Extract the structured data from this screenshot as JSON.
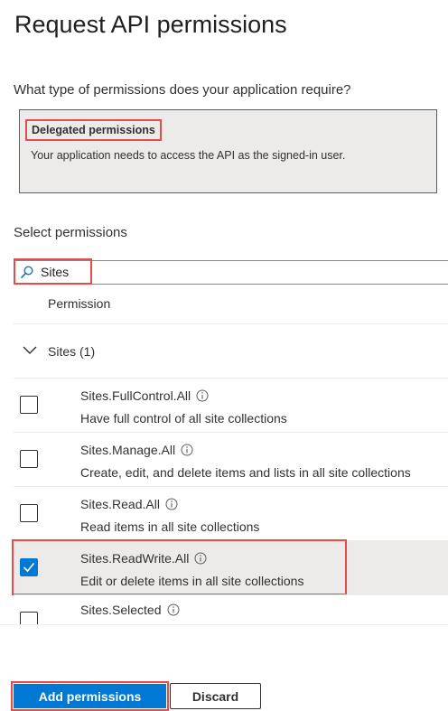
{
  "header": {
    "title": "Request API permissions",
    "question": "What type of permissions does your application require?"
  },
  "permission_type_card": {
    "title": "Delegated permissions",
    "description": "Your application needs to access the API as the signed-in user.",
    "selected": true
  },
  "select_section": {
    "label": "Select permissions",
    "search": {
      "value": "Sites",
      "icon": "search-icon"
    },
    "column_header": "Permission"
  },
  "group": {
    "label": "Sites (1)",
    "expanded": true,
    "icon": "chevron-down-icon"
  },
  "permissions": [
    {
      "name": "Sites.FullControl.All",
      "description": "Have full control of all site collections",
      "checked": false
    },
    {
      "name": "Sites.Manage.All",
      "description": "Create, edit, and delete items and lists in all site collections",
      "checked": false
    },
    {
      "name": "Sites.Read.All",
      "description": "Read items in all site collections",
      "checked": false
    },
    {
      "name": "Sites.ReadWrite.All",
      "description": "Edit or delete items in all site collections",
      "checked": true
    },
    {
      "name": "Sites.Selected",
      "description": "",
      "checked": false
    }
  ],
  "footer": {
    "primary_label": "Add permissions",
    "secondary_label": "Discard"
  },
  "colors": {
    "accent": "#0078d4",
    "highlight": "#e74c4c",
    "selected_row": "#edebe9"
  }
}
